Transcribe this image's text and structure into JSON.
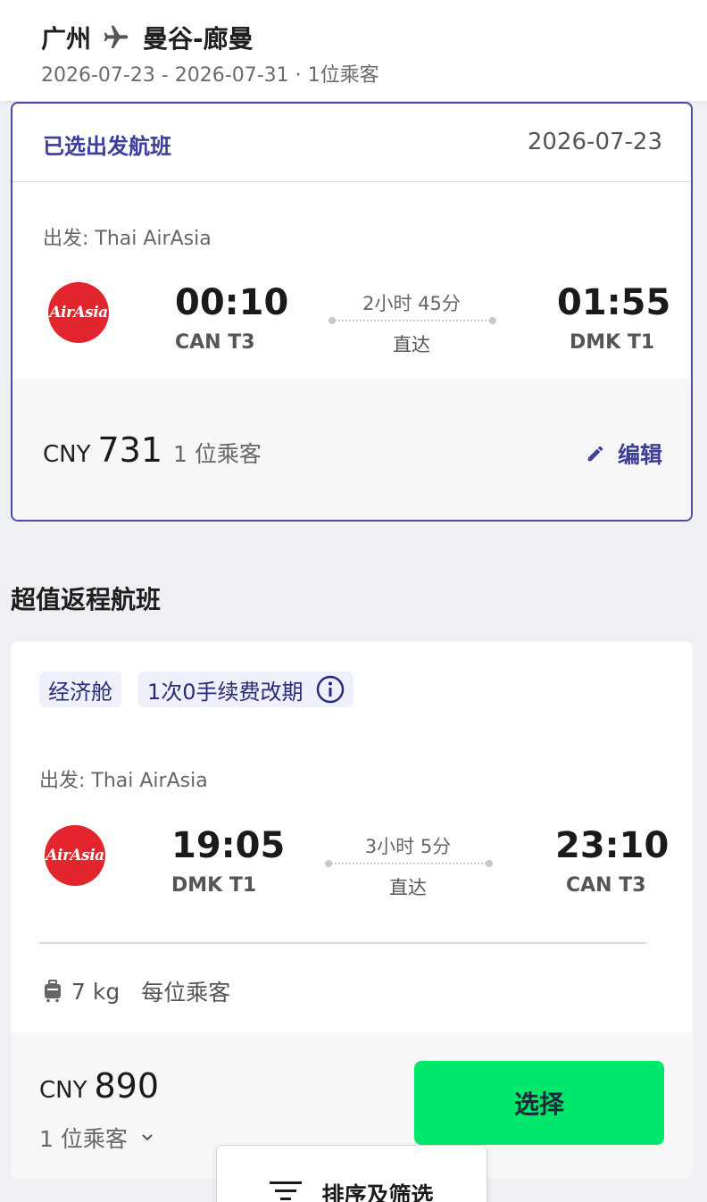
{
  "header": {
    "origin": "广州",
    "destination": "曼谷-廊曼",
    "trip_meta": "2026-07-23 - 2026-07-31 · 1位乘客"
  },
  "selected_outbound": {
    "title": "已选出发航班",
    "date": "2026-07-23",
    "carrier_label": "出发: Thai AirAsia",
    "logo_text": "AirAsia",
    "depart_time": "00:10",
    "depart_airport": "CAN T3",
    "duration": "2小时 45分",
    "stops": "直达",
    "arrive_time": "01:55",
    "arrive_airport": "DMK T1",
    "currency": "CNY",
    "price": "731",
    "passengers": "1 位乘客",
    "edit_label": "编辑"
  },
  "return_section": {
    "title": "超值返程航班"
  },
  "return_flight": {
    "cabin_badge": "经济舱",
    "change_badge": "1次0手续费改期",
    "carrier_label": "出发: Thai AirAsia",
    "logo_text": "AirAsia",
    "depart_time": "19:05",
    "depart_airport": "DMK T1",
    "duration": "3小时 5分",
    "stops": "直达",
    "arrive_time": "23:10",
    "arrive_airport": "CAN T3",
    "baggage": "7 kg",
    "baggage_note": "每位乘客",
    "currency": "CNY",
    "price": "890",
    "passengers": "1 位乘客",
    "select_label": "选择"
  },
  "filter": {
    "label": "排序及筛选"
  },
  "colors": {
    "brand_purple": "#3d3d9a",
    "airasia_red": "#e3262d",
    "select_green": "#00e86c",
    "page_bg": "#eef0f4"
  },
  "icons": [
    "plane-icon",
    "airasia-logo",
    "edit-icon",
    "info-icon",
    "luggage-icon",
    "chevron-down-icon",
    "filter-icon"
  ]
}
